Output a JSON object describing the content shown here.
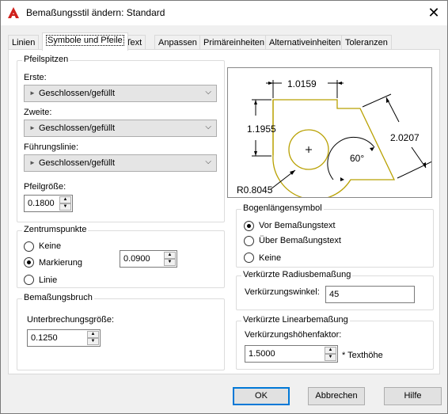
{
  "window": {
    "title": "Bemaßungsstil ändern: Standard",
    "close_glyph": "✕"
  },
  "tabs": [
    {
      "label": "Linien"
    },
    {
      "label": "Symbole und Pfeile"
    },
    {
      "label": "Text"
    },
    {
      "label": "Anpassen"
    },
    {
      "label": "Primäreinheiten"
    },
    {
      "label": "Alternativeinheiten"
    },
    {
      "label": "Toleranzen"
    }
  ],
  "arrowheads": {
    "title": "Pfeilspitzen",
    "first_label": "Erste:",
    "first_value": "Geschlossen/gefüllt",
    "second_label": "Zweite:",
    "second_value": "Geschlossen/gefüllt",
    "leader_label": "Führungslinie:",
    "leader_value": "Geschlossen/gefüllt",
    "size_label": "Pfeilgröße:",
    "size_value": "0.1800"
  },
  "center_marks": {
    "title": "Zentrumspunkte",
    "none": "Keine",
    "mark": "Markierung",
    "line": "Linie",
    "selected": "mark",
    "size_value": "0.0900"
  },
  "dim_break": {
    "title": "Bemaßungsbruch",
    "size_label": "Unterbrechungsgröße:",
    "size_value": "0.1250"
  },
  "preview": {
    "dim_top": "1.0159",
    "dim_left": "1.1955",
    "dim_diag": "2.0207",
    "dim_angle": "60°",
    "dim_radius": "R0.8045"
  },
  "arc_length": {
    "title": "Bogenlängensymbol",
    "opt_before": "Vor Bemaßungstext",
    "opt_above": "Über Bemaßungstext",
    "opt_none": "Keine",
    "selected": "before"
  },
  "jog_radius": {
    "title": "Verkürzte Radiusbemaßung",
    "angle_label": "Verkürzungswinkel:",
    "angle_value": "45"
  },
  "jog_linear": {
    "title": "Verkürzte Linearbemaßung",
    "factor_label": "Verkürzungshöhenfaktor:",
    "factor_value": "1.5000",
    "factor_suffix": "* Texthöhe"
  },
  "buttons": {
    "ok": "OK",
    "cancel": "Abbrechen",
    "help": "Hilfe"
  },
  "colors": {
    "accent": "#0078d7",
    "preview_shape": "#b8a000"
  }
}
